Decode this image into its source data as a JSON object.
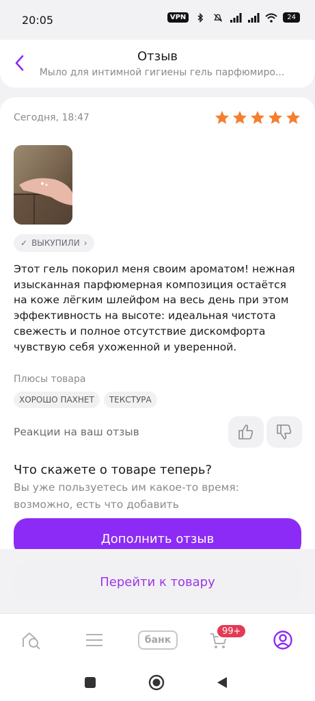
{
  "status": {
    "time": "20:05",
    "vpn": "VPN",
    "battery": "24"
  },
  "header": {
    "title": "Отзыв",
    "subtitle": "Мыло для интимной гигиены гель парфюмиро..."
  },
  "review": {
    "date": "Сегодня, 18:47",
    "rating": 5,
    "badge": "ВЫКУПИЛИ",
    "text": "Этот гель покорил меня своим ароматом! нежная изысканная парфюмерная композиция остаётся на коже лёгким шлейфом на весь день при этом эффективность на высоте: идеальная чистота свежесть и полное отсутствие дискомфорта чувствую себя ухоженной и уверенной.",
    "pros_label": "Плюсы товара",
    "tags": [
      "ХОРОШО ПАХНЕТ",
      "ТЕКСТУРА"
    ],
    "reactions_label": "Реакции на ваш отзыв"
  },
  "prompt": {
    "title": "Что скажете о товаре теперь?",
    "subtitle": "Вы уже пользуетесь им какое-то время: возможно, есть что добавить",
    "add_button": "Дополнить отзыв"
  },
  "go_button": "Перейти к товару",
  "nav": {
    "bank": "банк",
    "cart_badge": "99+"
  },
  "colors": {
    "accent": "#8c2bf5",
    "star": "#f57f2e",
    "badge": "#e53a55"
  }
}
